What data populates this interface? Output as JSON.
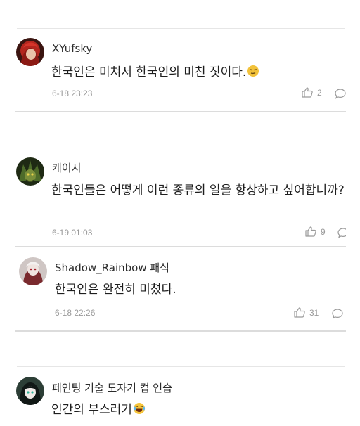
{
  "comments": [
    {
      "username": "XYufsky",
      "text": "한국인은 미쳐서 한국인의 미친 짓이다.",
      "emoji": "smug-face-emoji",
      "timestamp": "6-18 23:23",
      "likes": "2"
    },
    {
      "username": "케이지",
      "text": "한국인들은 어떻게 이런 종류의 일을 항상하고 싶어합니까?",
      "timestamp": "6-19 01:03",
      "likes": "9"
    },
    {
      "username": "Shadow_Rainbow 패식",
      "text": "한국인은 완전히 미쳤다.",
      "timestamp": "6-18 22:26",
      "likes": "31"
    },
    {
      "username": "페인팅 기술 도자기 컵 연습",
      "text": "인간의 부스러기",
      "emoji": "laughing-tears-emoji"
    }
  ]
}
